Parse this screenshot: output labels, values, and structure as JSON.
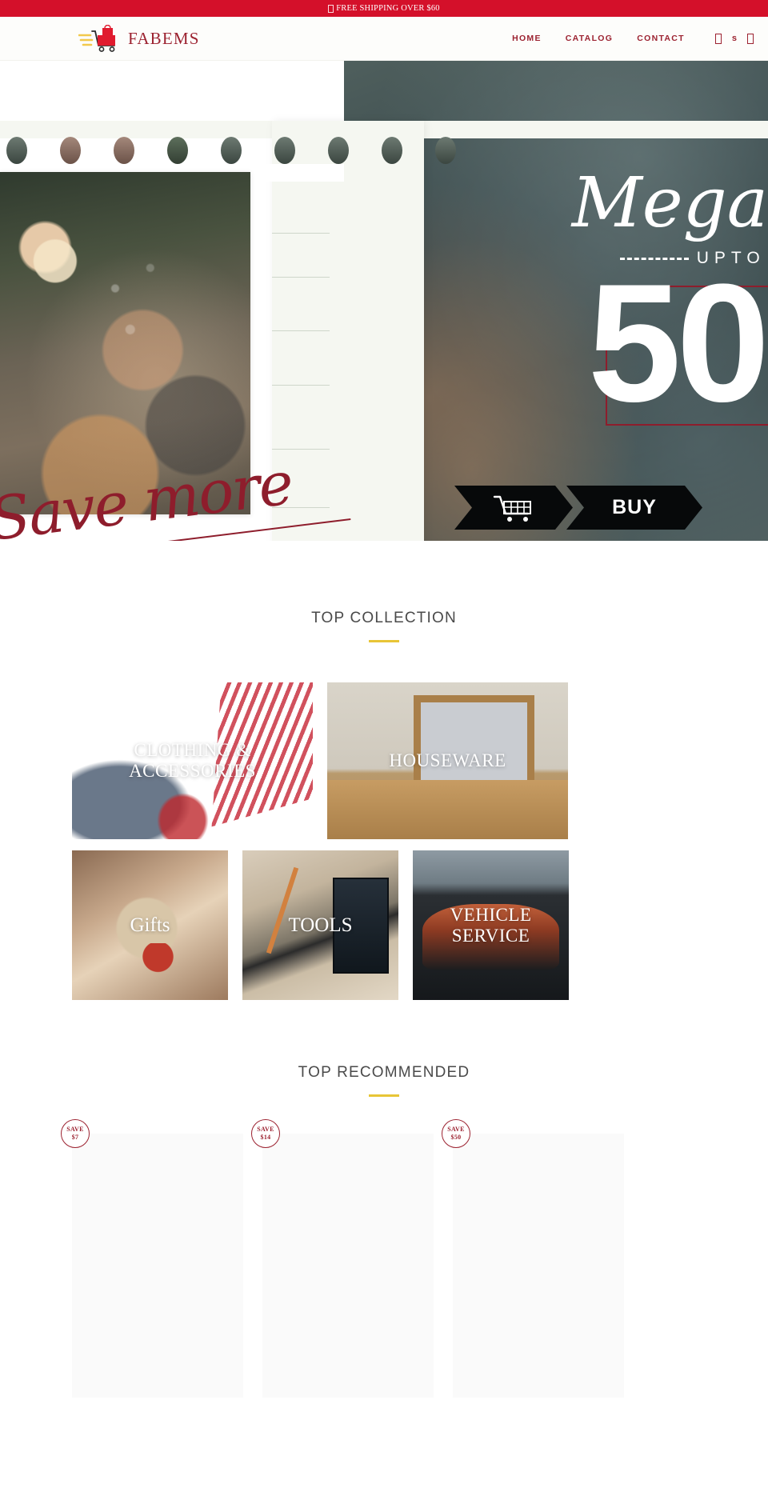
{
  "announcement": {
    "text": "FREE SHIPPING OVER $60",
    "icon": "truck-icon",
    "background": "#d4102a"
  },
  "header": {
    "brand_name": "FABEMS",
    "logo_icon": "shopping-cart-logo",
    "nav": [
      {
        "label": "HOME"
      },
      {
        "label": "CATALOG"
      },
      {
        "label": "CONTACT"
      }
    ],
    "icons": [
      {
        "name": "search-icon",
        "glyph": ""
      },
      {
        "name": "currency-selector",
        "glyph": "s"
      },
      {
        "name": "cart-icon",
        "glyph": ""
      }
    ],
    "accent_color": "#9c2230"
  },
  "hero": {
    "handwritten_text": "Save more",
    "promo_script": "Mega",
    "promo_upto": "UPTO",
    "promo_number": "50",
    "buy_label": "BUY",
    "cart_icon": "shopping-cart-icon",
    "outline_color": "#8e1d2c"
  },
  "collection": {
    "title": "TOP COLLECTION",
    "accent_color": "#e8c536",
    "tiles_top": [
      {
        "label": "CLOTHING &\nACCESSORIES",
        "name": "clothing-accessories"
      },
      {
        "label": "HOUSEWARE",
        "name": "houseware"
      }
    ],
    "tiles_bottom": [
      {
        "label": "Gifts",
        "name": "gifts"
      },
      {
        "label": "TOOLS",
        "name": "tools"
      },
      {
        "label": "VEHICLE\nSERVICE",
        "name": "vehicle-service"
      }
    ]
  },
  "recommended": {
    "title": "TOP RECOMMENDED",
    "accent_color": "#e8c536",
    "products": [
      {
        "save_word": "SAVE",
        "save_amount": "$7"
      },
      {
        "save_word": "SAVE",
        "save_amount": "$14"
      },
      {
        "save_word": "SAVE",
        "save_amount": "$50"
      }
    ]
  }
}
